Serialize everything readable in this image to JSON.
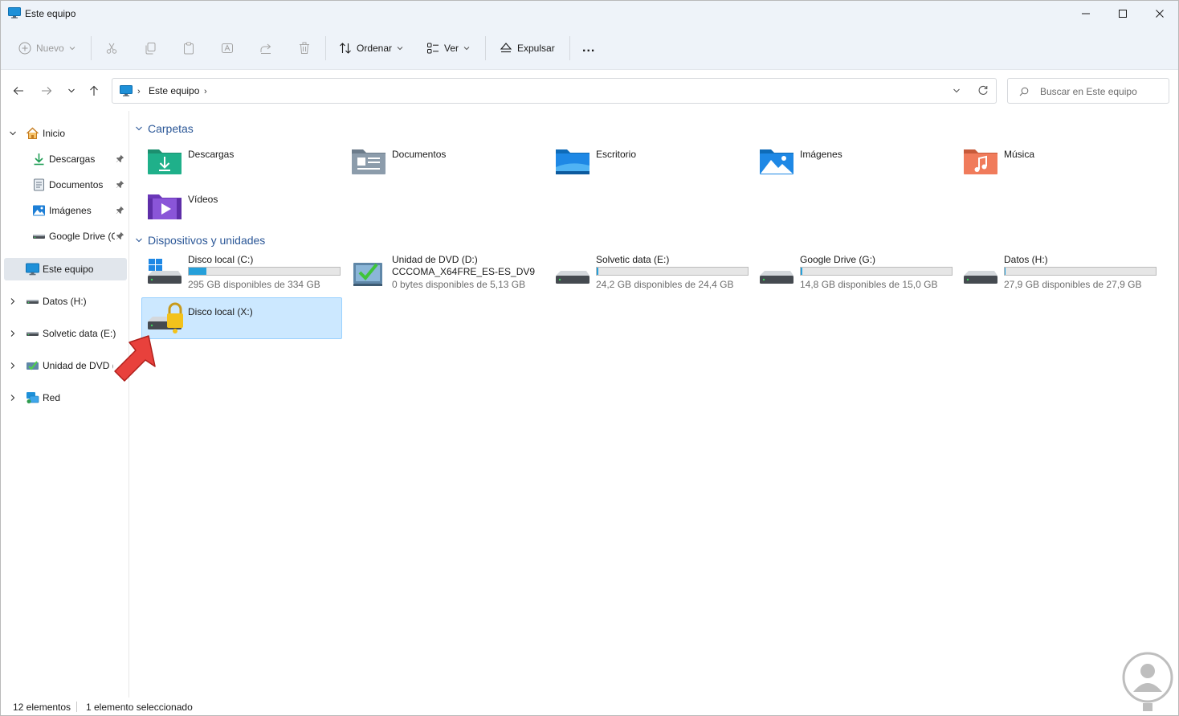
{
  "window": {
    "title": "Este equipo",
    "title_icon": "pc-monitor-icon"
  },
  "toolbar": {
    "new_label": "Nuevo",
    "sort_label": "Ordenar",
    "view_label": "Ver",
    "eject_label": "Expulsar",
    "more_label": "..."
  },
  "address": {
    "crumb": "Este equipo",
    "search_placeholder": "Buscar en Este equipo"
  },
  "sidebar": {
    "items": [
      {
        "label": "Inicio",
        "icon": "home-icon"
      },
      {
        "label": "Descargas",
        "icon": "download-icon",
        "pinned": true
      },
      {
        "label": "Documentos",
        "icon": "document-icon",
        "pinned": true
      },
      {
        "label": "Imágenes",
        "icon": "image-icon",
        "pinned": true
      },
      {
        "label": "Google Drive (G",
        "icon": "drive-icon",
        "pinned": true
      },
      {
        "label": "Este equipo",
        "icon": "pc-monitor-icon",
        "selected": true
      },
      {
        "label": "Datos (H:)",
        "icon": "drive-icon"
      },
      {
        "label": "Solvetic data (E:)",
        "icon": "drive-icon"
      },
      {
        "label": "Unidad de DVD (D:)",
        "icon": "dvd-icon"
      },
      {
        "label": "Red",
        "icon": "network-icon"
      }
    ]
  },
  "content": {
    "folders_header": "Carpetas",
    "devices_header": "Dispositivos y unidades",
    "folders": [
      {
        "name": "Descargas",
        "icon": "downloads-folder-icon"
      },
      {
        "name": "Documentos",
        "icon": "documents-folder-icon"
      },
      {
        "name": "Escritorio",
        "icon": "desktop-folder-icon"
      },
      {
        "name": "Imágenes",
        "icon": "pictures-folder-icon"
      },
      {
        "name": "Música",
        "icon": "music-folder-icon"
      },
      {
        "name": "Vídeos",
        "icon": "videos-folder-icon"
      }
    ],
    "drives": [
      {
        "name": "Disco local (C:)",
        "free": "295 GB disponibles de 334 GB",
        "used_fraction": 0.117
      },
      {
        "name": "Unidad de DVD (D:)",
        "name2": "CCCOMA_X64FRE_ES-ES_DV9",
        "free": "0 bytes disponibles de 5,13 GB"
      },
      {
        "name": "Solvetic data (E:)",
        "free": "24,2 GB disponibles de 24,4 GB",
        "used_fraction": 0.008
      },
      {
        "name": "Google Drive (G:)",
        "free": "14,8 GB disponibles de 15,0 GB",
        "used_fraction": 0.013
      },
      {
        "name": "Datos (H:)",
        "free": "27,9 GB disponibles de 27,9 GB",
        "used_fraction": 0.003
      },
      {
        "name": "Disco local (X:)",
        "selected": true,
        "icon": "locked-drive-icon"
      }
    ]
  },
  "status": {
    "count": "12 elementos",
    "selection": "1 elemento seleccionado"
  },
  "colors": {
    "accent": "#26a0da",
    "selection": "#cce8ff",
    "header_blue": "#2b5797",
    "arrow_red": "#e8413c"
  }
}
